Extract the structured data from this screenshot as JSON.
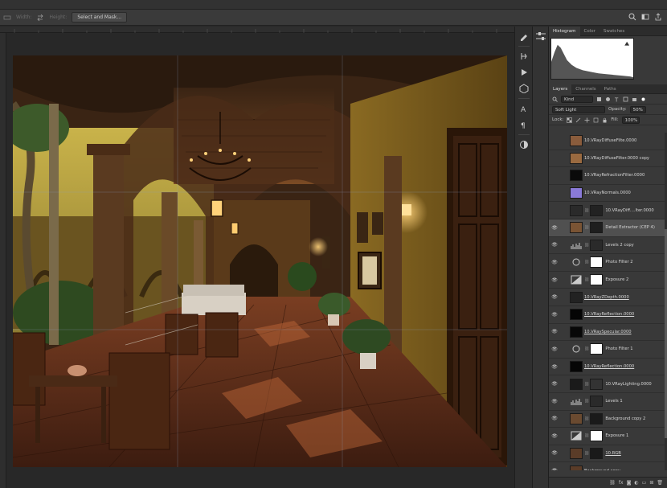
{
  "options_bar": {
    "width_label": "Width:",
    "height_label": "Height:",
    "select_mask_button": "Select and Mask..."
  },
  "panels": {
    "top_tabs": [
      "Histogram",
      "Color",
      "Swatches"
    ],
    "layer_tabs": [
      "Layers",
      "Channels",
      "Paths"
    ],
    "kind_filter": "Kind",
    "blend_mode": "Soft Light",
    "opacity_label": "Opacity:",
    "opacity_value": "50%",
    "lock_label": "Lock:",
    "fill_label": "Fill:",
    "fill_value": "100%"
  },
  "layers": [
    {
      "name": "10.VRayDiffuseFilte.0000",
      "visible": false,
      "thumb": "#8a5c3c",
      "mask": null,
      "selected": false,
      "underline": false
    },
    {
      "name": "10.VRayDiffuseFilter.0000 copy",
      "visible": false,
      "thumb": "#9a6a40",
      "mask": null,
      "selected": false,
      "underline": false
    },
    {
      "name": "10.VRayRefractionFilter.0000",
      "visible": false,
      "thumb": "#0a0a0a",
      "mask": null,
      "selected": false,
      "underline": false
    },
    {
      "name": "10.VRayNormals.0000",
      "visible": false,
      "thumb": "#8a7ad8",
      "mask": null,
      "selected": false,
      "underline": false
    },
    {
      "name": "10.VRayDiff....lter.0000",
      "visible": false,
      "thumb": "#2a2a2a",
      "mask": "#222222",
      "selected": false,
      "underline": false
    },
    {
      "name": "Detail Extractor (CEP 4)",
      "visible": true,
      "thumb": "#7a5434",
      "mask": "#1e1e1e",
      "selected": true,
      "underline": false
    },
    {
      "name": "Levels 2 copy",
      "visible": true,
      "thumb": "adj-levels",
      "mask": "#2a2a2a",
      "selected": false,
      "underline": false
    },
    {
      "name": "Photo Filter 2",
      "visible": true,
      "thumb": "adj-photo",
      "mask": "#ffffff",
      "selected": false,
      "underline": false
    },
    {
      "name": "Exposure 2",
      "visible": true,
      "thumb": "adj-exposure",
      "mask": "#ffffff",
      "selected": false,
      "underline": false
    },
    {
      "name": "10.VRayZDepth.0000",
      "visible": true,
      "thumb": "#222222",
      "mask": null,
      "selected": false,
      "underline": true
    },
    {
      "name": "10.VRayReflection.0000",
      "visible": true,
      "thumb": "#050505",
      "mask": null,
      "selected": false,
      "underline": true
    },
    {
      "name": "10.VRaySpecular.0000",
      "visible": true,
      "thumb": "#080808",
      "mask": null,
      "selected": false,
      "underline": true
    },
    {
      "name": "Photo Filter 1",
      "visible": true,
      "thumb": "adj-photo",
      "mask": "#ffffff",
      "selected": false,
      "underline": false
    },
    {
      "name": "10.VRayReflection.0000",
      "visible": true,
      "thumb": "#060606",
      "mask": null,
      "selected": false,
      "underline": true
    },
    {
      "name": "10.VRayLighting.0000",
      "visible": true,
      "thumb": "#1a1a1a",
      "mask": "#333333",
      "selected": false,
      "underline": false
    },
    {
      "name": "Levels 1",
      "visible": true,
      "thumb": "adj-levels",
      "mask": "#2a2a2a",
      "selected": false,
      "underline": false
    },
    {
      "name": "Background copy 2",
      "visible": true,
      "thumb": "#6a4a30",
      "mask": "#1a1a1a",
      "selected": false,
      "underline": false
    },
    {
      "name": "Exposure 1",
      "visible": true,
      "thumb": "adj-exposure",
      "mask": "#ffffff",
      "selected": false,
      "underline": false
    },
    {
      "name": "10.RGB",
      "visible": true,
      "thumb": "#5a3c28",
      "mask": "#1a1a1a",
      "selected": false,
      "underline": true
    },
    {
      "name": "Background copy",
      "visible": true,
      "thumb": "#5a3c28",
      "mask": null,
      "selected": false,
      "underline": false
    }
  ],
  "footer_icons": [
    "link-icon",
    "fx-icon",
    "mask-icon",
    "adjustment-icon",
    "group-icon",
    "new-layer-icon",
    "trash-icon"
  ],
  "colors": {
    "app_bg": "#282828",
    "panel_bg": "#393939",
    "selected_layer": "#505050"
  }
}
